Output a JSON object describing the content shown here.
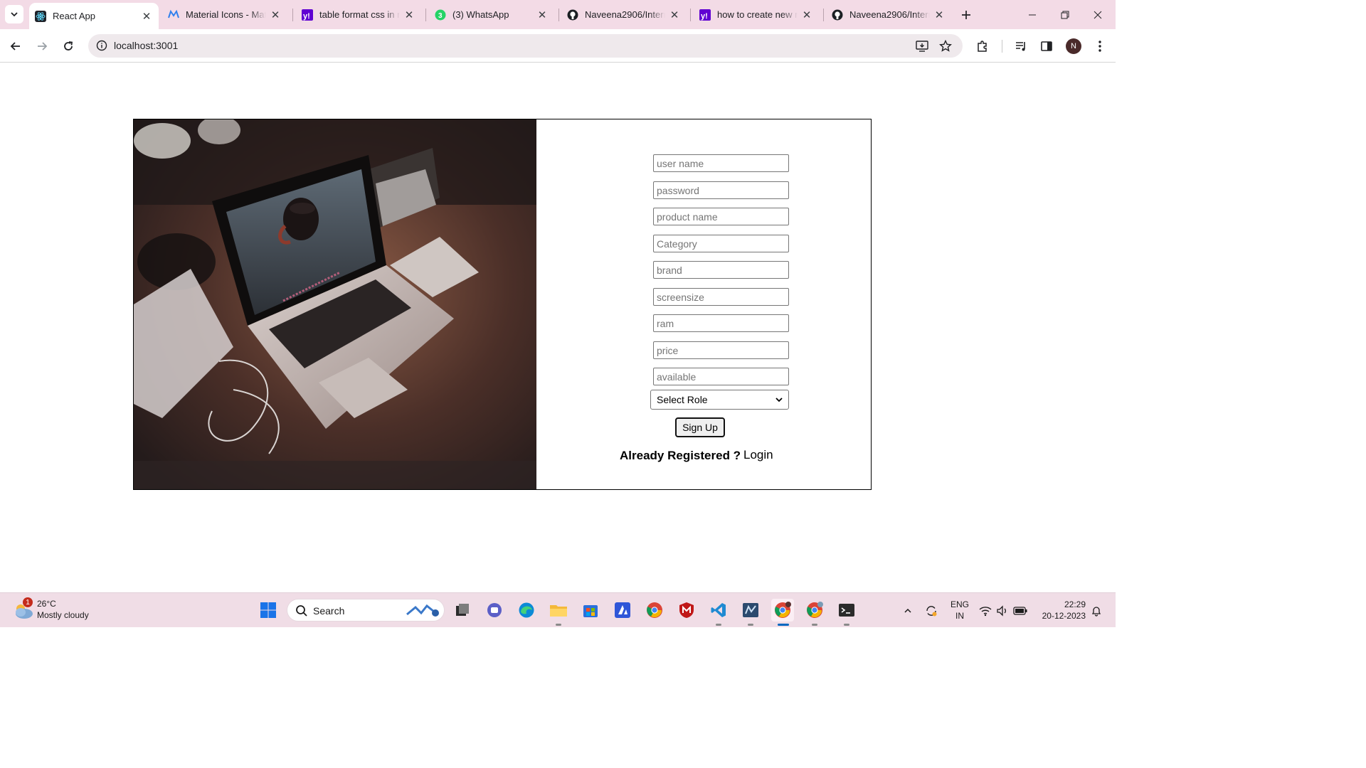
{
  "browser": {
    "tabs": [
      {
        "title": "React App",
        "icon": "react-icon",
        "active": true
      },
      {
        "title": "Material Icons - Material",
        "icon": "material-icon",
        "active": false
      },
      {
        "title": "table format css in react",
        "icon": "yahoo-icon",
        "active": false
      },
      {
        "title": "(3) WhatsApp",
        "icon": "whatsapp-icon",
        "active": false
      },
      {
        "title": "Naveena2906/Internship",
        "icon": "github-icon",
        "active": false
      },
      {
        "title": "how to create new react",
        "icon": "yahoo-icon",
        "active": false
      },
      {
        "title": "Naveena2906/Internship",
        "icon": "github-icon",
        "active": false
      }
    ],
    "url": "localhost:3001",
    "profile_initial": "N"
  },
  "form": {
    "fields": [
      {
        "placeholder": "user name"
      },
      {
        "placeholder": "password"
      },
      {
        "placeholder": "product name"
      },
      {
        "placeholder": "Category"
      },
      {
        "placeholder": "brand"
      },
      {
        "placeholder": "screensize"
      },
      {
        "placeholder": "ram"
      },
      {
        "placeholder": "price"
      },
      {
        "placeholder": "available"
      }
    ],
    "role_select": "Select Role",
    "signup_label": "Sign Up",
    "already_text": "Already Registered ?",
    "login_label": "Login"
  },
  "taskbar": {
    "weather_temp": "26°C",
    "weather_cond": "Mostly cloudy",
    "weather_badge": "1",
    "search_label": "Search",
    "lang_line1": "ENG",
    "lang_line2": "IN",
    "time": "22:29",
    "date": "20-12-2023"
  },
  "colors": {
    "tabstrip": "#f3dbe6",
    "taskbar": "#f0dde6",
    "accent": "#0067c0"
  }
}
